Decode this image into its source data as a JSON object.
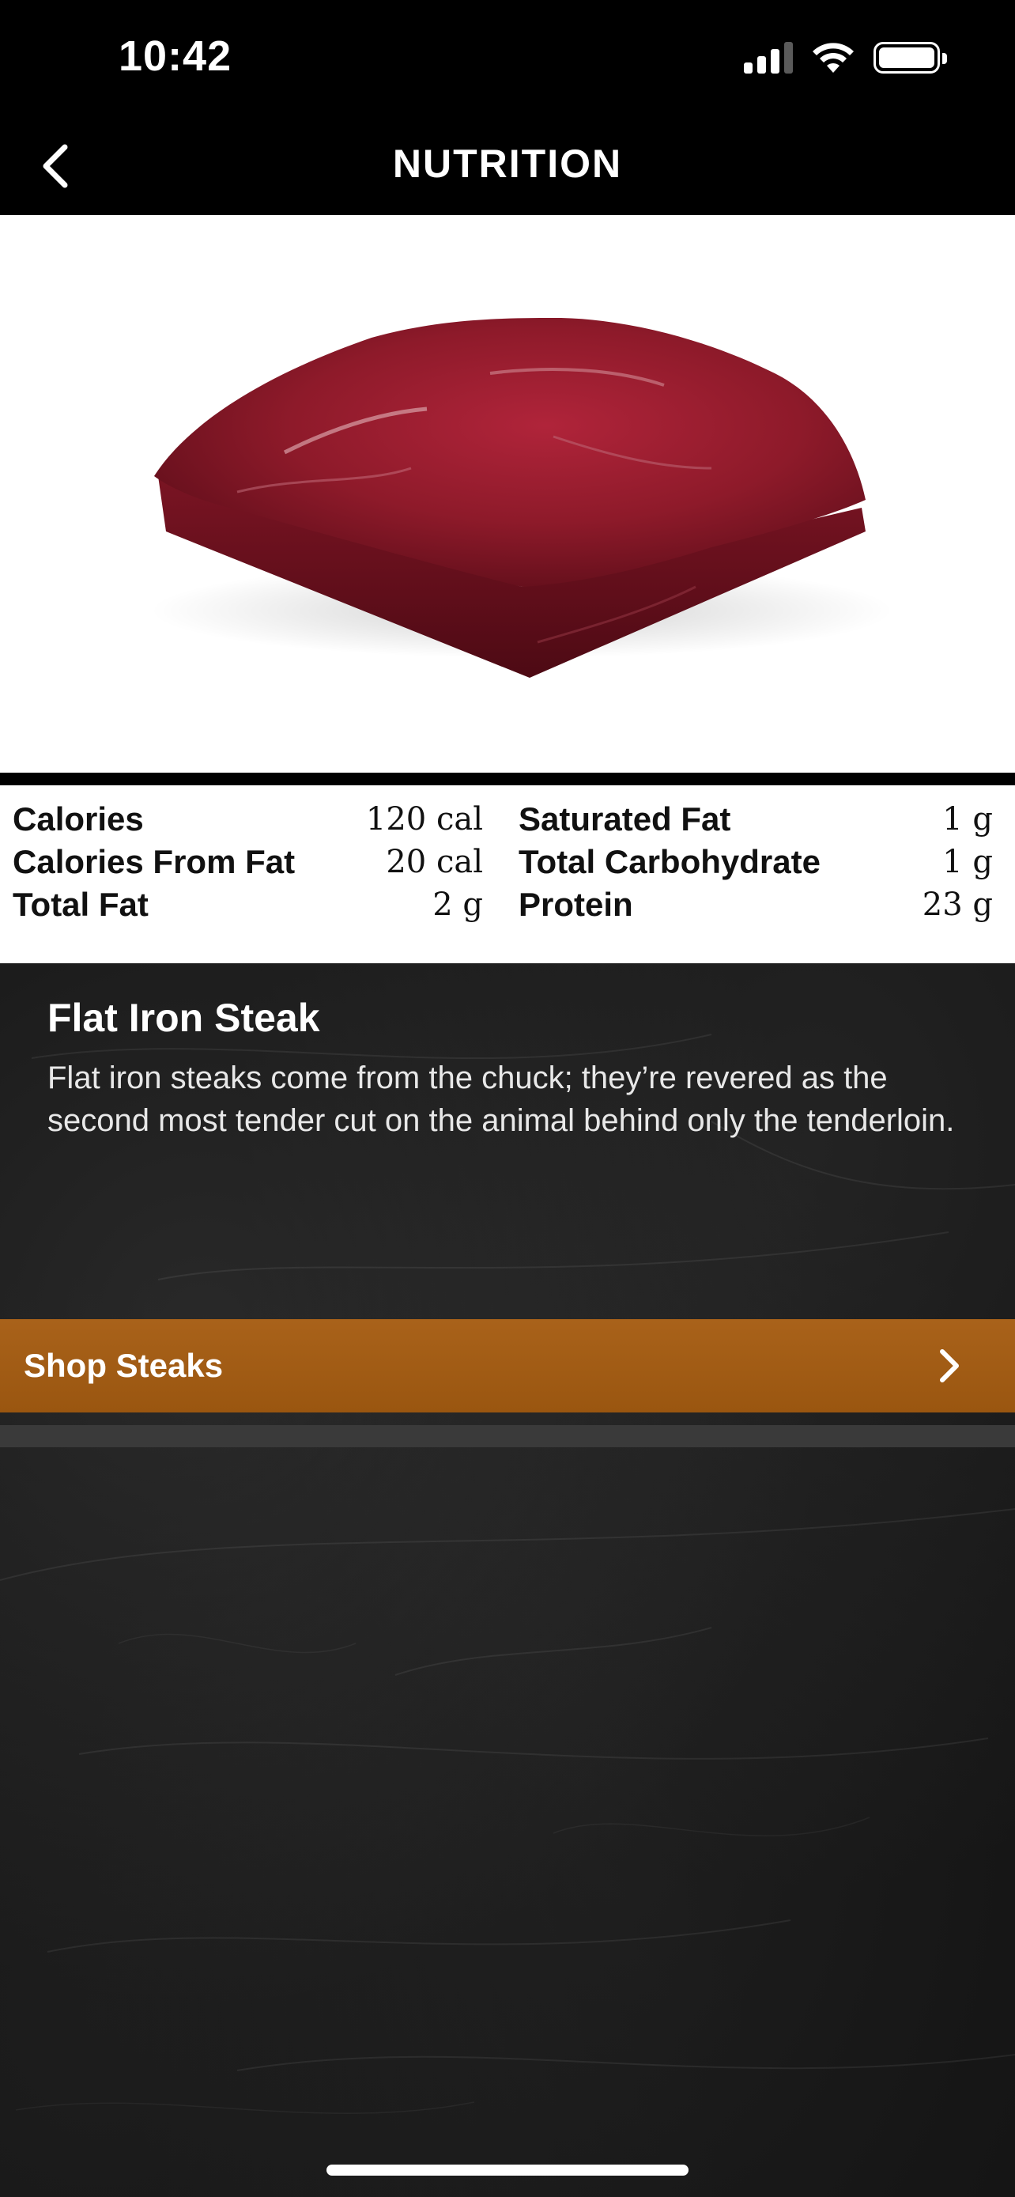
{
  "status_bar": {
    "time": "10:42"
  },
  "nav": {
    "title": "NUTRITION"
  },
  "nutrition": {
    "left": [
      {
        "label": "Calories",
        "value": "120 cal"
      },
      {
        "label": "Calories From Fat",
        "value": "20 cal"
      },
      {
        "label": "Total Fat",
        "value": "2 g"
      }
    ],
    "right": [
      {
        "label": "Saturated Fat",
        "value": "1 g"
      },
      {
        "label": "Total Carbohydrate",
        "value": "1 g"
      },
      {
        "label": "Protein",
        "value": "23 g"
      }
    ]
  },
  "product": {
    "title": "Flat Iron Steak",
    "description": "Flat iron steaks come from the chuck; they’re revered as the second most tender cut on the animal behind only the tenderloin."
  },
  "shop": {
    "label": "Shop Steaks"
  },
  "colors": {
    "accent": "#a9621a",
    "background": "#141414"
  },
  "icons": [
    "chevron-left-icon",
    "signal-icon",
    "wifi-icon",
    "battery-icon",
    "chevron-right-icon"
  ]
}
